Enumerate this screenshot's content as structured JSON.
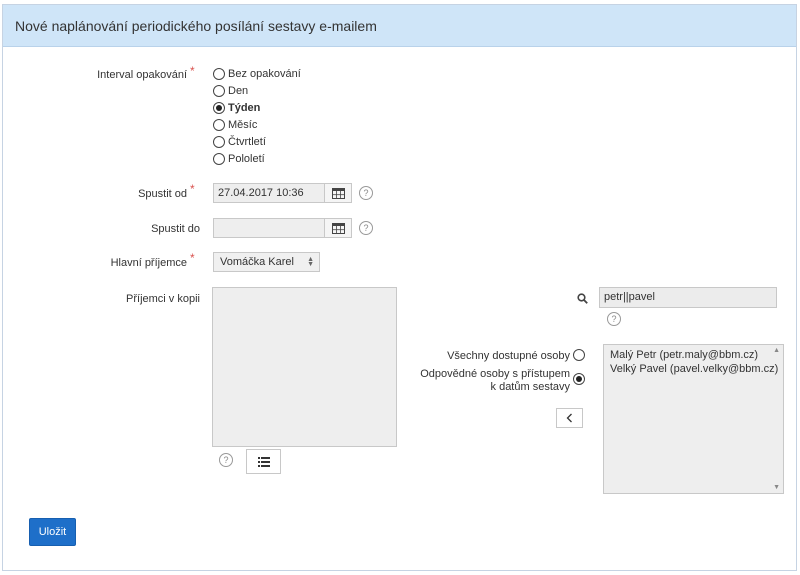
{
  "dialog": {
    "title": "Nové naplánování periodického posílání sestavy e-mailem"
  },
  "interval": {
    "label": "Interval opakování",
    "required_mark": "*",
    "options": [
      {
        "label": "Bez opakování",
        "checked": false
      },
      {
        "label": "Den",
        "checked": false
      },
      {
        "label": "Týden",
        "checked": true
      },
      {
        "label": "Měsíc",
        "checked": false
      },
      {
        "label": "Čtvrtletí",
        "checked": false
      },
      {
        "label": "Pololetí",
        "checked": false
      }
    ]
  },
  "start_from": {
    "label": "Spustit od",
    "required_mark": "*",
    "value": "27.04.2017 10:36",
    "help": "?"
  },
  "start_to": {
    "label": "Spustit do",
    "value": "",
    "help": "?"
  },
  "main_recipient": {
    "label": "Hlavní příjemce",
    "required_mark": "*",
    "value": "Vomáčka Karel"
  },
  "cc_recipients": {
    "label": "Příjemci v kopii",
    "help": "?"
  },
  "search": {
    "value": "petr||pavel",
    "help": "?"
  },
  "person_filter": {
    "all_label": "Všechny dostupné osoby",
    "responsible_label": "Odpovědné osoby s přístupem k datům sestavy",
    "selected": "responsible"
  },
  "available_people": [
    "Malý Petr (petr.maly@bbm.cz)",
    "Velký Pavel (pavel.velky@bbm.cz)"
  ],
  "actions": {
    "save_label": "Uložit"
  }
}
